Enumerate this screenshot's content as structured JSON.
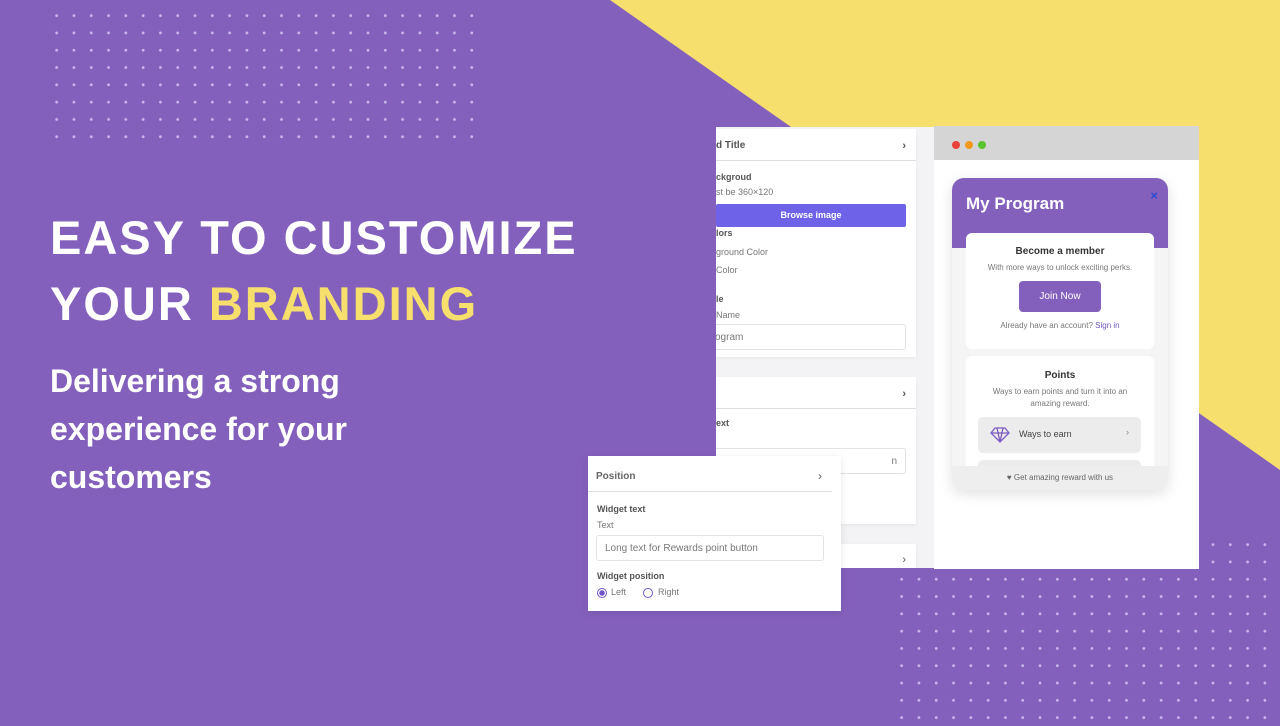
{
  "colors": {
    "purple": "#8460bd",
    "yellow": "#f7df6e",
    "button": "#6d62e8"
  },
  "hero": {
    "line1": "EASY TO CUSTOMIZE",
    "line2_a": "YOUR ",
    "line2_b": "BRANDING",
    "subtitle": "Delivering a strong experience for your customers"
  },
  "settings": {
    "card1": {
      "header": "d Title",
      "background_label": "ckgroud",
      "size_hint": "st be 360×120",
      "browse": "Browse image",
      "colors_label": "lors",
      "bg_color": "ground Color",
      "text_color": "Color",
      "title_label": "le",
      "name_label": "Name",
      "name_value": "ogram"
    },
    "card2": {
      "text_label": "ext",
      "input_value": "n"
    }
  },
  "position_panel": {
    "header": "Position",
    "widget_text": "Widget text",
    "text_label": "Text",
    "text_value": "Long text for Rewards point button",
    "widget_position": "Widget position",
    "left": "Left",
    "right": "Right",
    "selected": "Left"
  },
  "widget": {
    "title": "My Program",
    "close": "×",
    "member_title": "Become a member",
    "member_text": "With more ways to unlock exciting perks.",
    "join": "Join Now",
    "account_text": "Already have an account?",
    "sign_in": "Sign in",
    "points_title": "Points",
    "points_text": "Ways to earn points and turn it into an amazing reward.",
    "ways_to_earn": "Ways to earn",
    "footer": "Get amazing reward with us",
    "footer_icon": "heart-icon"
  }
}
